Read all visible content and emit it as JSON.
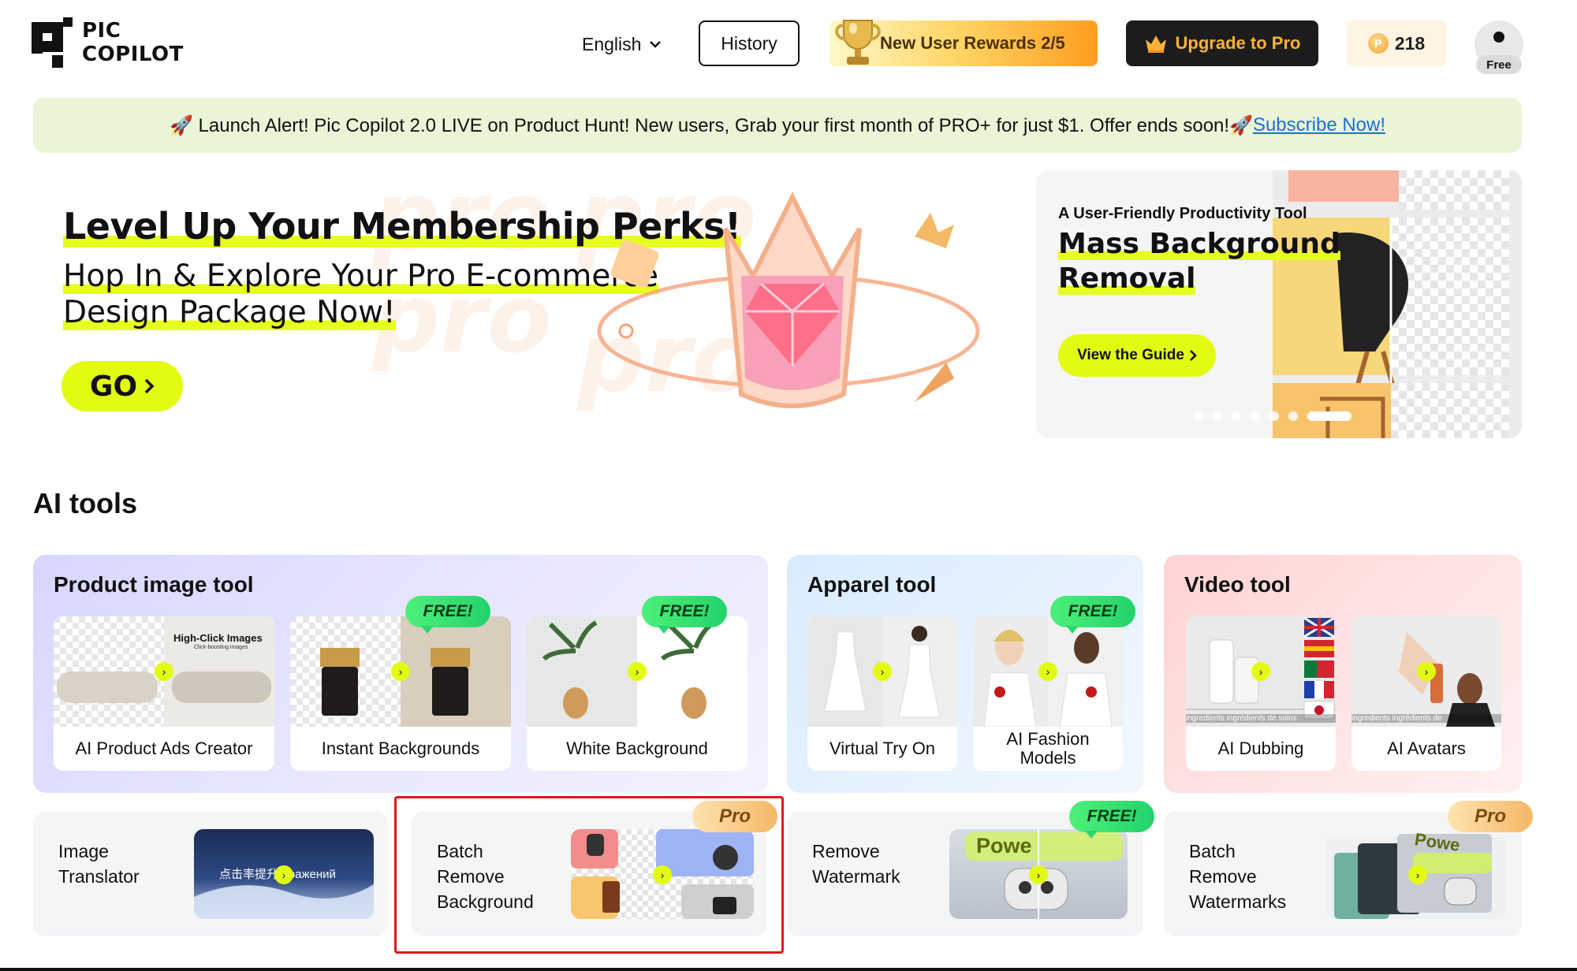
{
  "header": {
    "logo_line1": "PIC",
    "logo_line2": "COPILOT",
    "language": "English",
    "history_label": "History",
    "rewards_label": "New User Rewards 2/5",
    "upgrade_label": "Upgrade to Pro",
    "credits": "218",
    "plan_badge": "Free"
  },
  "alert": {
    "text": "🚀 Launch Alert! Pic Copilot 2.0 LIVE on Product Hunt! New users, Grab your first month of PRO+ for just $1. Offer ends soon!🚀",
    "link": "Subscribe Now!"
  },
  "hero": {
    "title": "Level Up Your Membership Perks!",
    "subtitle_line1": "Hop In & Explore Your Pro E-commerce",
    "subtitle_line2": "Design Package Now!",
    "cta": "GO",
    "watermark": "pro"
  },
  "side_banner": {
    "tagline": "A User-Friendly Productivity Tool",
    "title_line1": "Mass Background",
    "title_line2": "Removal",
    "cta": "View the Guide",
    "slides": 7,
    "active_slide": 7
  },
  "ai_tools": {
    "heading": "AI tools",
    "groups": [
      {
        "title": "Product image tool",
        "cards": [
          {
            "label": "AI Product Ads Creator",
            "badge": "",
            "img_text": "High-Click Images",
            "img_subtext": "Click-boosting images"
          },
          {
            "label": "Instant Backgrounds",
            "badge": "FREE!"
          },
          {
            "label": "White Background",
            "badge": "FREE!"
          }
        ]
      },
      {
        "title": "Apparel tool",
        "cards": [
          {
            "label": "Virtual Try On",
            "badge": ""
          },
          {
            "label": "AI Fashion Models",
            "badge": "FREE!"
          }
        ]
      },
      {
        "title": "Video tool",
        "cards": [
          {
            "label": "AI Dubbing",
            "badge": "",
            "img_caption": "ingredients ingrédients de soins"
          },
          {
            "label": "AI Avatars",
            "badge": "",
            "img_caption": "ingredients ingrédients de"
          }
        ]
      }
    ],
    "more_tools": [
      {
        "label_lines": [
          "Image",
          "Translator"
        ],
        "badge": "",
        "img_text": "点击率提升 бражений"
      },
      {
        "label_lines": [
          "Batch",
          "Remove",
          "Background"
        ],
        "badge": "Pro"
      },
      {
        "label_lines": [
          "Remove",
          "Watermark"
        ],
        "badge": "FREE!",
        "img_text": "Powe"
      },
      {
        "label_lines": [
          "Batch",
          "Remove",
          "Watermarks"
        ],
        "badge": "Pro",
        "img_text": "Powe"
      }
    ]
  },
  "colors": {
    "accent_lime": "#e3fb13",
    "free_badge": "#2bd86f",
    "pro_badge": "#f5b867",
    "highlight_box": "#e0171c",
    "link": "#1b6fd8"
  },
  "icons": [
    "logo-mark-icon",
    "chevron-down-icon",
    "trophy-icon",
    "crown-icon",
    "coin-icon",
    "user-icon",
    "chevron-right-icon"
  ]
}
